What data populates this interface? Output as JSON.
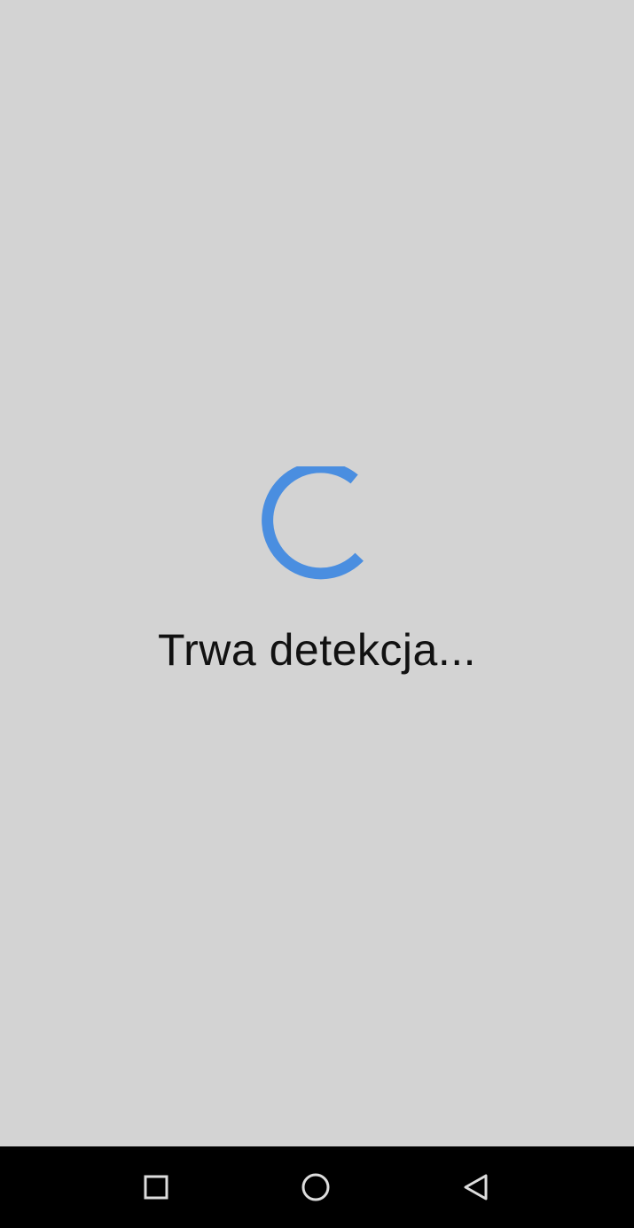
{
  "status": {
    "message": "Trwa detekcja..."
  },
  "spinner": {
    "icon": "loading-spinner-icon",
    "color": "#4a8ee0"
  },
  "navbar": {
    "recent_icon": "square-icon",
    "home_icon": "circle-icon",
    "back_icon": "triangle-back-icon"
  },
  "colors": {
    "background": "#d3d3d3",
    "navbar": "#000000",
    "accent": "#4a8ee0"
  }
}
